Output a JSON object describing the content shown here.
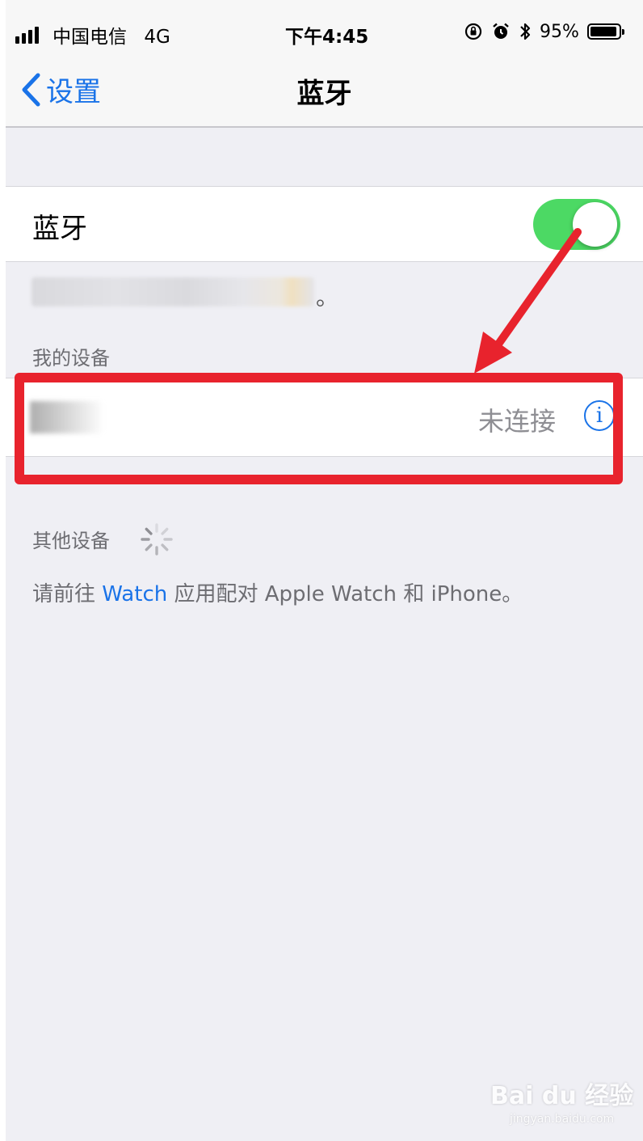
{
  "status_bar": {
    "carrier": "中国电信",
    "network": "4G",
    "time": "下午4:45",
    "battery_percent": "95%",
    "battery_level": 0.95,
    "icons": [
      "signal-icon",
      "orientation-lock-icon",
      "alarm-icon",
      "bluetooth-icon",
      "battery-icon"
    ]
  },
  "nav": {
    "back_label": "设置",
    "title": "蓝牙"
  },
  "bluetooth": {
    "label": "蓝牙",
    "enabled": true
  },
  "sections": {
    "my_devices_header": "我的设备",
    "other_devices_header": "其他设备"
  },
  "devices": [
    {
      "status": "未连接"
    }
  ],
  "pair_note": {
    "prefix": "请前往 ",
    "link": "Watch",
    "suffix": " 应用配对 Apple Watch 和 iPhone。"
  },
  "watermark": {
    "main": "Bai du 经验",
    "sub": "jingyan.baidu.com"
  },
  "colors": {
    "accent": "#1a73e8",
    "toggle_on": "#4cd964",
    "annotation_red": "#e8232d",
    "background": "#efeff4"
  }
}
